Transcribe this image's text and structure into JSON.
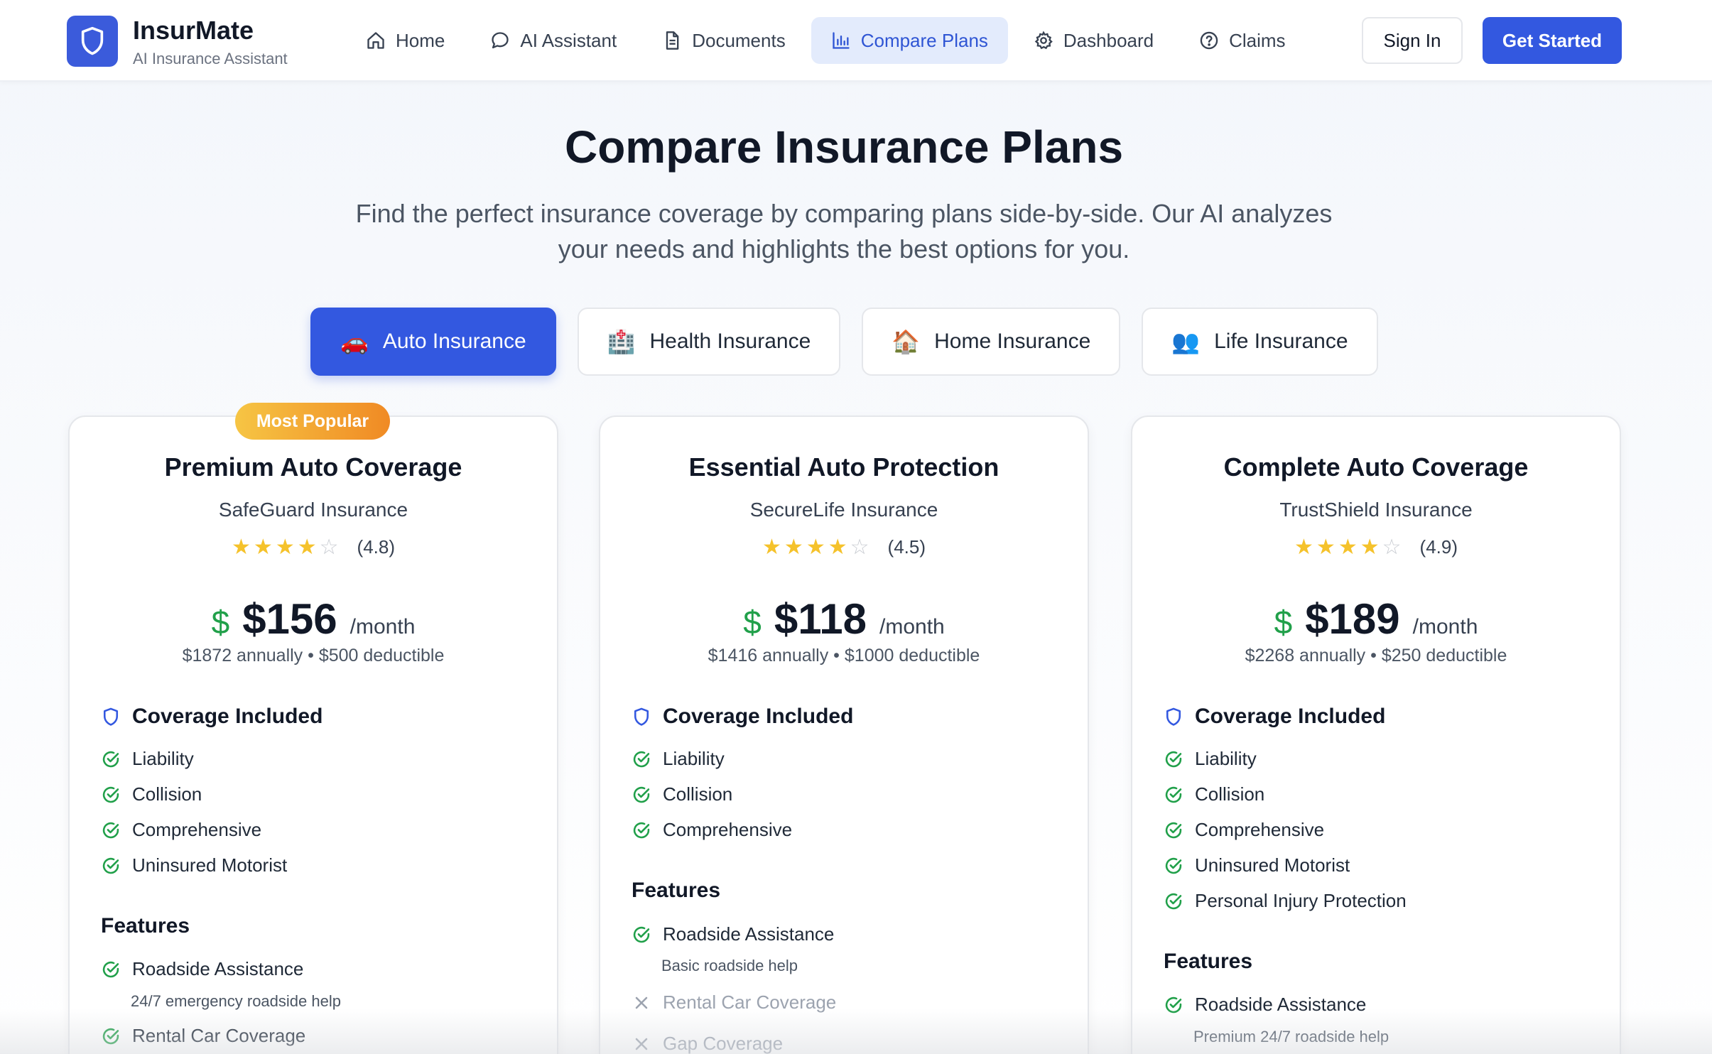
{
  "header": {
    "brand_name": "InsurMate",
    "brand_sub": "AI Insurance Assistant",
    "nav": [
      {
        "label": "Home",
        "icon": "home-icon"
      },
      {
        "label": "AI Assistant",
        "icon": "chat-icon"
      },
      {
        "label": "Documents",
        "icon": "document-icon"
      },
      {
        "label": "Compare Plans",
        "icon": "bar-chart-icon",
        "active": true
      },
      {
        "label": "Dashboard",
        "icon": "gear-icon"
      },
      {
        "label": "Claims",
        "icon": "help-circle-icon"
      }
    ],
    "sign_in": "Sign In",
    "get_started": "Get Started"
  },
  "hero": {
    "title": "Compare Insurance Plans",
    "subtitle": "Find the perfect insurance coverage by comparing plans side-by-side. Our AI analyzes your needs and highlights the best options for you."
  },
  "tabs": [
    {
      "emoji": "🚗",
      "label": "Auto Insurance",
      "active": true
    },
    {
      "emoji": "🏥",
      "label": "Health Insurance"
    },
    {
      "emoji": "🏠",
      "label": "Home Insurance"
    },
    {
      "emoji": "👥",
      "label": "Life Insurance"
    }
  ],
  "colors": {
    "accent": "#3358e0",
    "check": "#21a04a",
    "star": "#f5c22b",
    "badge_start": "#f6c544",
    "badge_end": "#f08a24"
  },
  "cards": [
    {
      "badge": "Most Popular",
      "name": "Premium Auto Coverage",
      "provider": "SafeGuard Insurance",
      "stars_filled": 4,
      "stars_total": 5,
      "rating": "(4.8)",
      "price": "$156",
      "per": "/month",
      "annual": "$1872 annually",
      "deductible": "$500 deductible",
      "coverage_title": "Coverage Included",
      "coverage": [
        "Liability",
        "Collision",
        "Comprehensive",
        "Uninsured Motorist"
      ],
      "features_title": "Features",
      "features": [
        {
          "name": "Roadside Assistance",
          "desc": "24/7 emergency roadside help",
          "included": true
        },
        {
          "name": "Rental Car Coverage",
          "desc": "",
          "included": true
        }
      ]
    },
    {
      "name": "Essential Auto Protection",
      "provider": "SecureLife Insurance",
      "stars_filled": 4,
      "stars_total": 5,
      "rating": "(4.5)",
      "price": "$118",
      "per": "/month",
      "annual": "$1416 annually",
      "deductible": "$1000 deductible",
      "coverage_title": "Coverage Included",
      "coverage": [
        "Liability",
        "Collision",
        "Comprehensive"
      ],
      "features_title": "Features",
      "features": [
        {
          "name": "Roadside Assistance",
          "desc": "Basic roadside help",
          "included": true
        },
        {
          "name": "Rental Car Coverage",
          "desc": "",
          "included": false
        },
        {
          "name": "Gap Coverage",
          "desc": "",
          "included": false
        }
      ]
    },
    {
      "name": "Complete Auto Coverage",
      "provider": "TrustShield Insurance",
      "stars_filled": 4,
      "stars_total": 5,
      "rating": "(4.9)",
      "price": "$189",
      "per": "/month",
      "annual": "$2268 annually",
      "deductible": "$250 deductible",
      "coverage_title": "Coverage Included",
      "coverage": [
        "Liability",
        "Collision",
        "Comprehensive",
        "Uninsured Motorist",
        "Personal Injury Protection"
      ],
      "features_title": "Features",
      "features": [
        {
          "name": "Roadside Assistance",
          "desc": "Premium 24/7 roadside help",
          "included": true
        }
      ]
    }
  ]
}
